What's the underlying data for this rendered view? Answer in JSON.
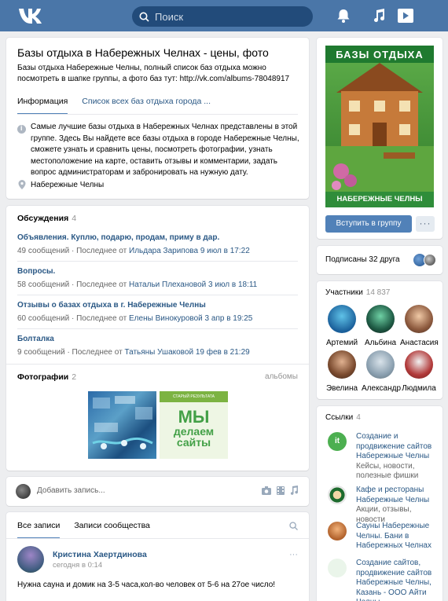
{
  "header": {
    "search_placeholder": "Поиск",
    "icons": [
      "vk-logo-icon",
      "search-icon",
      "bell-icon",
      "music-icon",
      "video-icon"
    ]
  },
  "group": {
    "title": "Базы отдыха в Набережных Челнах - цены, фото",
    "status": "Базы отдыха Набережные Челны, полный список баз отдыха можно посмотреть в шапке группы, а фото баз тут: http://vk.com/albums-78048917",
    "tabs": [
      "Информация",
      "Список всех баз отдыха города ..."
    ],
    "description": "Самые лучшие базы отдыха в Набережных Челнах представлены в этой группе. Здесь Вы найдете все базы отдыха в городе Набережные Челны, сможете узнать и сравнить цены, посмотреть фотографии, узнать местоположение на карте, оставить отзывы и комментарии, задать вопрос администраторам и забронировать на нужную дату.",
    "location": "Набережные Челны"
  },
  "discussions": {
    "title": "Обсуждения",
    "count": "4",
    "topics": [
      {
        "title": "Объявления. Куплю, подарю, продам, приму в дар.",
        "meta": "49 сообщений  ·  Последнее от ",
        "author": "Ильдара Зарипова",
        "date": "9 июл в 17:22"
      },
      {
        "title": "Вопросы.",
        "meta": "58 сообщений  ·  Последнее от ",
        "author": "Натальи Плехановой",
        "date": "3 июл в 18:11"
      },
      {
        "title": "Отзывы о базах отдыха в г. Набережные Челны",
        "meta": "60 сообщений  ·  Последнее от ",
        "author": "Елены Винокуровой",
        "date": "3 апр в 19:25"
      },
      {
        "title": "Болталка",
        "meta": "9 сообщений  ·  Последнее от ",
        "author": "Татьяны Ушаковой",
        "date": "19 фев в 21:29"
      }
    ]
  },
  "photos": {
    "title": "Фотографии",
    "count": "2",
    "albums_link": "альбомы",
    "photo2_top": "СТАРЫЙ РЕЗУЛЬТАТА",
    "photo2_text": [
      "МЫ",
      "делаем",
      "сайты"
    ]
  },
  "composer": {
    "placeholder": "Добавить запись..."
  },
  "wall": {
    "tabs": [
      "Все записи",
      "Записи сообщества"
    ],
    "post": {
      "author": "Кристина Хаертдинова",
      "time": "сегодня в 0:14",
      "text": "Нужна сауна и домик на 3-5 часа,кол-во человек от 5-6 на 27ое число!",
      "more": "···"
    }
  },
  "cover": {
    "top_text": "БАЗЫ ОТДЫХА",
    "bottom_text": "НАБЕРЕЖНЫЕ ЧЕЛНЫ"
  },
  "join_button": "Вступить в группу",
  "more_button": "···",
  "friends": {
    "text": "Подписаны 32 друга"
  },
  "members": {
    "title": "Участники",
    "count": "14 837",
    "list": [
      "Артемий",
      "Альбина",
      "Анастасия",
      "Эвелина",
      "Александр",
      "Людмила"
    ]
  },
  "links": {
    "title": "Ссылки",
    "count": "4",
    "items": [
      {
        "name": "Создание и продвижение сайтов Набережные Челны",
        "desc": "Кейсы, новости, полезные фишки"
      },
      {
        "name": "Кафе и рестораны Набережные Челны",
        "desc": "Акции, отзывы, новости"
      },
      {
        "name": "Сауны Набережные Челны. Бани в Набережных Челнах",
        "desc": ""
      },
      {
        "name": "Создание сайтов, продвижение сайтов Набережные Челны, Казань - ООО Айти Челны",
        "desc": ""
      }
    ]
  },
  "colors": {
    "header": "#4a76a8",
    "link": "#2a5885",
    "button": "#5181b8",
    "background": "#edeef0"
  }
}
